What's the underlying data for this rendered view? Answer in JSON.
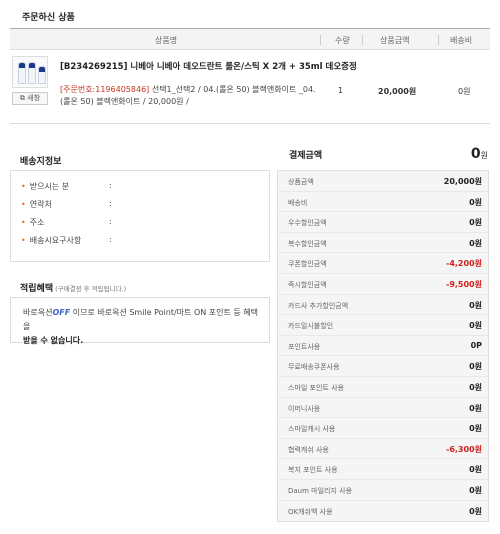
{
  "section_title": "주문하신 상품",
  "table_headers": {
    "product": "상품명",
    "qty": "수량",
    "price": "상품금액",
    "shipping": "배송비"
  },
  "product": {
    "name": "[B234269215] 니베아 니베아 데오드란트 롤온/스틱 X 2개 + 35ml 데오증정",
    "order_no": "[주문번호:1196405846]",
    "option_text": "선택1_선택2 / 04.(롤온 50) 블랙앤화이트 _04.(롤온 50) 블랙앤화이트 / 20,000원 /",
    "new_window_label": "새창",
    "qty": "1",
    "price": "20,000원",
    "shipping": "0원"
  },
  "delivery": {
    "title": "배송지정보",
    "rows": [
      {
        "label": "받으시는 분",
        "colon": ":"
      },
      {
        "label": "연락처",
        "colon": ":"
      },
      {
        "label": "주소",
        "colon": ":"
      },
      {
        "label": "배송시요구사항",
        "colon": ":"
      }
    ]
  },
  "points": {
    "title": "적립혜택",
    "subtitle": "(구매결정 후 적립됩니다.)",
    "prefix": "바로옥션",
    "off": "OFF",
    "text_1": " 이므로 바로옥션 Smile Point/마트 ON 포인트 등 혜택을",
    "text_2": "받을 수 없습니다."
  },
  "payment": {
    "title": "결제금액",
    "total": "0",
    "total_unit": "원",
    "rows": [
      {
        "label": "상품금액",
        "value": "20,000원",
        "negative": false
      },
      {
        "label": "배송비",
        "value": "0원",
        "negative": false
      },
      {
        "label": "우수할인금액",
        "value": "0원",
        "negative": false
      },
      {
        "label": "복수할인금액",
        "value": "0원",
        "negative": false
      },
      {
        "label": "쿠폰할인금액",
        "value": "-4,200원",
        "negative": true
      },
      {
        "label": "즉시할인금액",
        "value": "-9,500원",
        "negative": true
      },
      {
        "label": "카드사 추가할인금액",
        "value": "0원",
        "negative": false
      },
      {
        "label": "카드일시불할인",
        "value": "0원",
        "negative": false
      },
      {
        "label": "포인트사용",
        "value": "0P",
        "negative": false
      },
      {
        "label": "무료배송쿠폰사용",
        "value": "0원",
        "negative": false
      },
      {
        "label": "스마일 포인트 사용",
        "value": "0원",
        "negative": false
      },
      {
        "label": "이머니사용",
        "value": "0원",
        "negative": false
      },
      {
        "label": "스마일캐시 사용",
        "value": "0원",
        "negative": false
      },
      {
        "label": "협력캐쉬 사용",
        "value": "-6,300원",
        "negative": true
      },
      {
        "label": "복지 포인트 사용",
        "value": "0원",
        "negative": false
      },
      {
        "label": "Daum 마일리지 사용",
        "value": "0원",
        "negative": false
      },
      {
        "label": "OK캐쉬백 사용",
        "value": "0원",
        "negative": false
      }
    ]
  },
  "colors": {
    "accent_red": "#d0201c",
    "order_no": "#c5331e",
    "off_blue": "#3b63c8",
    "bullet": "#e06a1a"
  }
}
